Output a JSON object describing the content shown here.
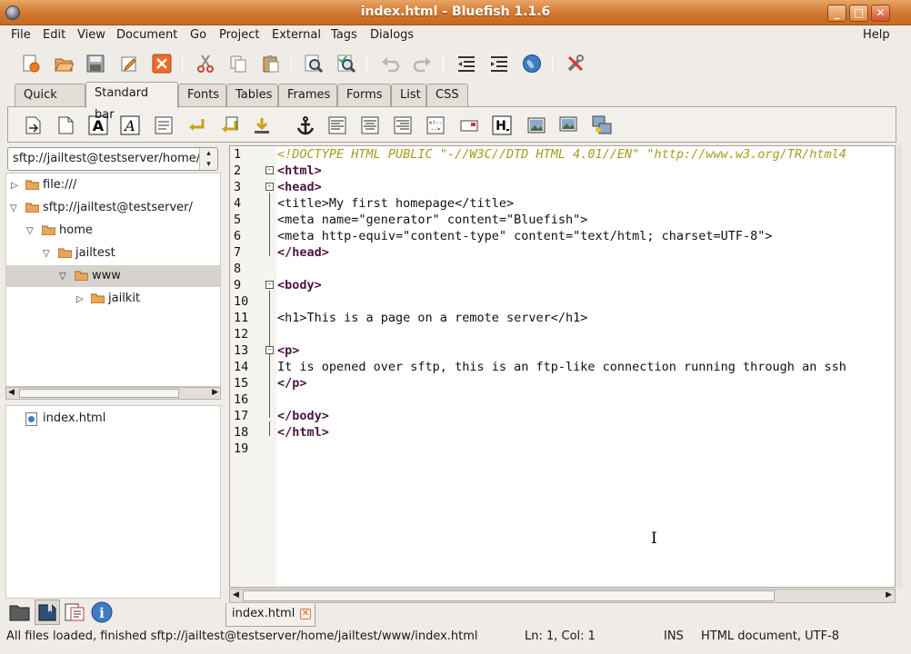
{
  "window": {
    "title": "index.html - Bluefish 1.1.6",
    "controls": [
      "minimize-icon",
      "maximize-icon",
      "close-icon"
    ]
  },
  "menubar": [
    "File",
    "Edit",
    "View",
    "Document",
    "Go",
    "Project",
    "External",
    "Tags",
    "Dialogs"
  ],
  "menubar_right": "Help",
  "toolbar": {
    "icons": [
      "new-file-icon",
      "open-folder-icon",
      "save-icon",
      "save-as-icon",
      "close-file-icon",
      "cut-icon",
      "copy-icon",
      "paste-icon",
      "find-icon",
      "replace-icon",
      "undo-icon",
      "redo-icon",
      "unindent-icon",
      "indent-icon",
      "preview-globe-icon",
      "preferences-tools-icon"
    ]
  },
  "tabs": [
    "Quick bar",
    "Standard bar",
    "Fonts",
    "Tables",
    "Frames",
    "Forms",
    "List",
    "CSS"
  ],
  "active_tab": "Standard bar",
  "standard_bar": {
    "icons": [
      "quickstart-icon",
      "body-icon",
      "bold-icon",
      "italic-icon",
      "paragraph-icon",
      "break-icon",
      "break-clear-all-icon",
      "nbsp-icon",
      "anchor-icon",
      "align-left-icon",
      "align-center-icon",
      "align-right-icon",
      "comment-icon",
      "email-icon",
      "heading-icon",
      "insert-image-icon",
      "insert-thumbnail-icon",
      "multi-thumbnail-icon"
    ]
  },
  "sidebar": {
    "location": "sftp://jailtest@testserver/home/jailtest/www",
    "tree": [
      {
        "label": "file:///",
        "expanded": false,
        "depth": 0
      },
      {
        "label": "sftp://jailtest@testserver/",
        "expanded": true,
        "depth": 0
      },
      {
        "label": "home",
        "expanded": true,
        "depth": 1
      },
      {
        "label": "jailtest",
        "expanded": true,
        "depth": 2
      },
      {
        "label": "www",
        "expanded": true,
        "depth": 3,
        "selected": true
      },
      {
        "label": "jailkit",
        "expanded": false,
        "depth": 4
      }
    ],
    "files": [
      "index.html"
    ],
    "bottom_tabs": [
      "filebrowser-icon",
      "bookmarks-icon",
      "document-list-icon",
      "info-icon"
    ]
  },
  "editor": {
    "line_numbers": [
      "1",
      "2",
      "3",
      "4",
      "5",
      "6",
      "7",
      "8",
      "9",
      "10",
      "11",
      "12",
      "13",
      "14",
      "15",
      "16",
      "17",
      "18",
      "19"
    ],
    "lines": [
      "<!DOCTYPE HTML PUBLIC \"-//W3C//DTD HTML 4.01//EN\" \"http://www.w3.org/TR/html4",
      "<html>",
      "<head>",
      "<title>My first homepage</title>",
      "<meta name=\"generator\" content=\"Bluefish\">",
      "<meta http-equiv=\"content-type\" content=\"text/html; charset=UTF-8\">",
      "</head>",
      "",
      "<body>",
      "",
      "<h1>This is a page on a remote server</h1>",
      "",
      "<p>",
      "It is opened over sftp, this is an ftp-like connection running through an ssh",
      "</p>",
      "",
      "</body>",
      "</html>",
      ""
    ],
    "document_tab": "index.html"
  },
  "statusbar": {
    "message": "All files loaded, finished sftp://jailtest@testserver/home/jailtest/www/index.html",
    "position": "Ln: 1, Col: 1",
    "mode": "INS",
    "doctype": "HTML document, UTF-8"
  }
}
